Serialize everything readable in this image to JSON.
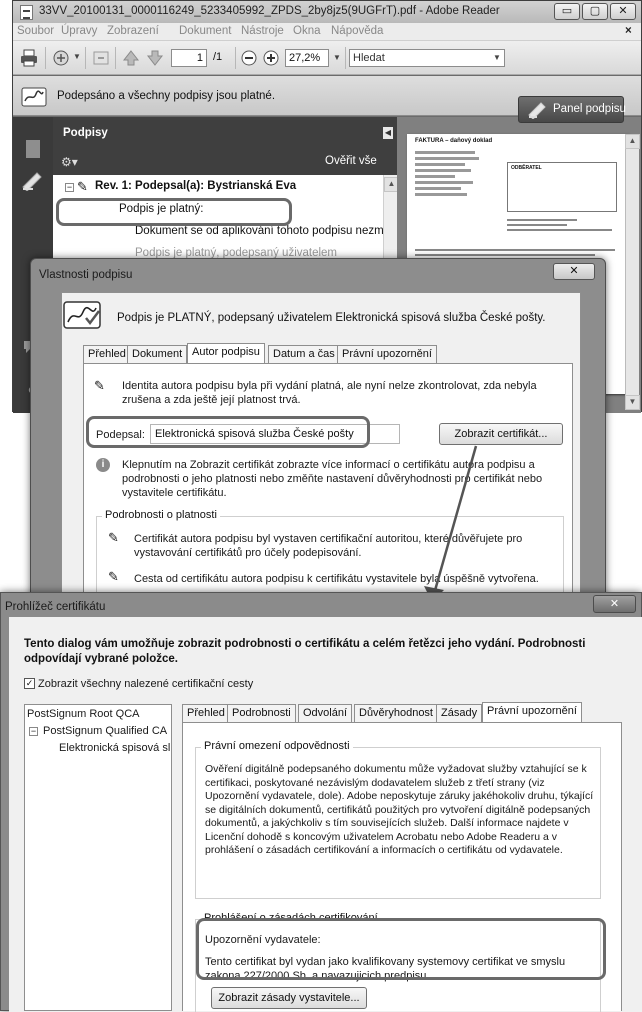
{
  "reader": {
    "title": "33VV_20100131_0000116249_5233405992_ZPDS_2by8jz5(9UGFrT).pdf - Adobe Reader",
    "window_buttons": [
      "▭",
      "▢",
      "✕"
    ],
    "menu": [
      "Soubor",
      "Úpravy",
      "Zobrazení",
      "Dokument",
      "Nástroje",
      "Okna",
      "Nápověda"
    ],
    "menu_close": "×",
    "toolbar": {
      "page_current": "1",
      "page_total": "/1",
      "zoom": "27,2%",
      "search_placeholder": "Hledat"
    },
    "signature_bar": {
      "status": "Podepsáno a všechny podpisy jsou platné.",
      "panel_button": "Panel podpisu"
    },
    "signatures_panel": {
      "title": "Podpisy",
      "verify_all": "Ověřit vše",
      "tree": [
        "Rev. 1: Podepsal(a): Bystrianská Eva",
        "Podpis je platný:",
        "Dokument se od aplikování tohoto podpisu nezměn",
        "Podpis je platný, podepsaný uživatelem"
      ]
    },
    "document": {
      "heading": "FAKTURA – daňový doklad",
      "box_label": "ODBĚRATEL"
    }
  },
  "signature_properties": {
    "title": "Vlastnosti podpisu",
    "header": "Podpis je PLATNÝ, podepsaný uživatelem Elektronická spisová služba České pošty.",
    "tabs": [
      "Přehled",
      "Dokument",
      "Autor podpisu",
      "Datum a čas",
      "Právní upozornění"
    ],
    "active_tab": "Autor podpisu",
    "identity_note": "Identita autora podpisu byla při vydání platná, ale nyní nelze zkontrolovat, zda nebyla zrušena a zda ještě její platnost trvá.",
    "signed_by_label": "Podepsal:",
    "signed_by_value": "Elektronická spisová služba České pošty",
    "show_certificate_button": "Zobrazit certifikát...",
    "info_text": "Klepnutím na Zobrazit certifikát zobrazte více informací o certifikátu autora podpisu a podrobnosti o jeho platnosti nebo změňte nastavení důvěryhodnosti pro certifikát nebo vystavitele certifikátu.",
    "validity_group_label": "Podrobnosti o platnosti",
    "validity_items": [
      "Certifikát autora podpisu byl vystaven certifikační autoritou, které důvěřujete pro vystavování certifikátů pro účely podepisování.",
      "Cesta od certifikátu autora podpisu k certifikátu vystavitele byla úspěšně vytvořena."
    ]
  },
  "certificate_viewer": {
    "title": "Prohlížeč certifikátu",
    "close_label": "✕",
    "intro": "Tento dialog vám umožňuje zobrazit podrobnosti o certifikátu a celém řetězci jeho vydání. Podrobnosti odpovídají vybrané položce.",
    "show_all_paths_label": "Zobrazit všechny nalezené certifikační cesty",
    "show_all_paths_checked": true,
    "tree": [
      "PostSignum Root QCA",
      "PostSignum Qualified CA",
      "Elektronická spisová sl"
    ],
    "tabs": [
      "Přehled",
      "Podrobnosti",
      "Odvolání",
      "Důvěryhodnost",
      "Zásady",
      "Právní upozornění"
    ],
    "active_tab": "Právní upozornění",
    "legal_group_label": "Právní omezení odpovědnosti",
    "legal_text": "Ověření digitálně podepsaného dokumentu může vyžadovat služby vztahující se k certifikaci, poskytované nezávislým dodavatelem služeb z třetí strany (viz Upozornění vydavatele, dole). Adobe neposkytuje záruky jakéhokoliv druhu, týkající se digitálních dokumentů, certifikátů použitých pro vytvoření digitálně podepsaných dokumentů, a jakýchkoliv s tím souvisejících služeb. Další informace najdete v Licenční dohodě s koncovým uživatelem Acrobatu nebo Adobe Readeru a v prohlášení o zásadách certifikování a informacích o certifikátu od vydavatele.",
    "policy_group_label": "Prohlášení o zásadách certifikování",
    "issuer_notice_label": "Upozornění vydavatele:",
    "issuer_notice_text": "Tento certifikat byl vydan jako kvalifikovany systemovy certifikat ve smyslu zakona 227/2000 Sb. a navazujicich predpisu.",
    "show_policy_button": "Zobrazit zásady vystavitele..."
  }
}
